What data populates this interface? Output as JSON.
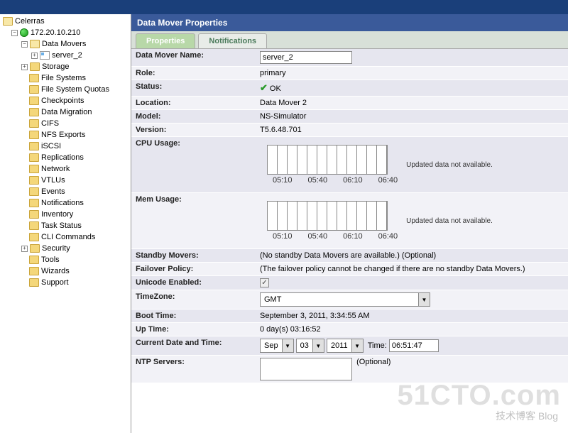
{
  "sidebar": {
    "root": "Celerras",
    "host": "172.20.10.210",
    "items": [
      {
        "label": "Data Movers",
        "expanded": true,
        "children": [
          {
            "label": "server_2",
            "icon": "srv"
          }
        ]
      },
      {
        "label": "Storage",
        "expanded": false
      },
      {
        "label": "File Systems"
      },
      {
        "label": "File System Quotas"
      },
      {
        "label": "Checkpoints"
      },
      {
        "label": "Data Migration"
      },
      {
        "label": "CIFS"
      },
      {
        "label": "NFS Exports"
      },
      {
        "label": "iSCSI"
      },
      {
        "label": "Replications"
      },
      {
        "label": "Network"
      },
      {
        "label": "VTLUs"
      },
      {
        "label": "Events"
      },
      {
        "label": "Notifications"
      },
      {
        "label": "Inventory"
      },
      {
        "label": "Task Status"
      },
      {
        "label": "CLI Commands"
      },
      {
        "label": "Security",
        "expanded": false
      },
      {
        "label": "Tools"
      },
      {
        "label": "Wizards"
      },
      {
        "label": "Support"
      }
    ]
  },
  "header": {
    "title": "Data Mover Properties"
  },
  "tabs": {
    "properties": "Properties",
    "notifications": "Notifications"
  },
  "props": {
    "name_label": "Data Mover Name:",
    "name_value": "server_2",
    "role_label": "Role:",
    "role_value": "primary",
    "status_label": "Status:",
    "status_value": "OK",
    "location_label": "Location:",
    "location_value": "Data Mover 2",
    "model_label": "Model:",
    "model_value": "NS-Simulator",
    "version_label": "Version:",
    "version_value": "T5.6.48.701",
    "cpu_label": "CPU Usage:",
    "mem_label": "Mem Usage:",
    "chart_note": "Updated data not available.",
    "standby_label": "Standby Movers:",
    "standby_value": "(No standby Data Movers are available.) (Optional)",
    "failover_label": "Failover Policy:",
    "failover_value": "(The failover policy cannot be changed if there are no standby Data Movers.)",
    "unicode_label": "Unicode Enabled:",
    "unicode_checked": true,
    "timezone_label": "TimeZone:",
    "timezone_value": "GMT",
    "boot_label": "Boot Time:",
    "boot_value": "September 3, 2011, 3:34:55 AM",
    "uptime_label": "Up Time:",
    "uptime_value": "0 day(s) 03:16:52",
    "curtime_label": "Current Date and Time:",
    "month": "Sep",
    "day": "03",
    "year": "2011",
    "time_label": "Time:",
    "time_value": "06:51:47",
    "ntp_label": "NTP Servers:",
    "ntp_optional": "(Optional)"
  },
  "chart_data": {
    "type": "bar",
    "cpu": {
      "x_ticks": [
        "05:10",
        "05:40",
        "06:10",
        "06:40"
      ],
      "note": "Updated data not available."
    },
    "mem": {
      "x_ticks": [
        "05:10",
        "05:40",
        "06:10",
        "06:40"
      ],
      "note": "Updated data not available."
    }
  },
  "watermark": {
    "logo": "51CTO.com",
    "sub": "技术博客   Blog"
  }
}
